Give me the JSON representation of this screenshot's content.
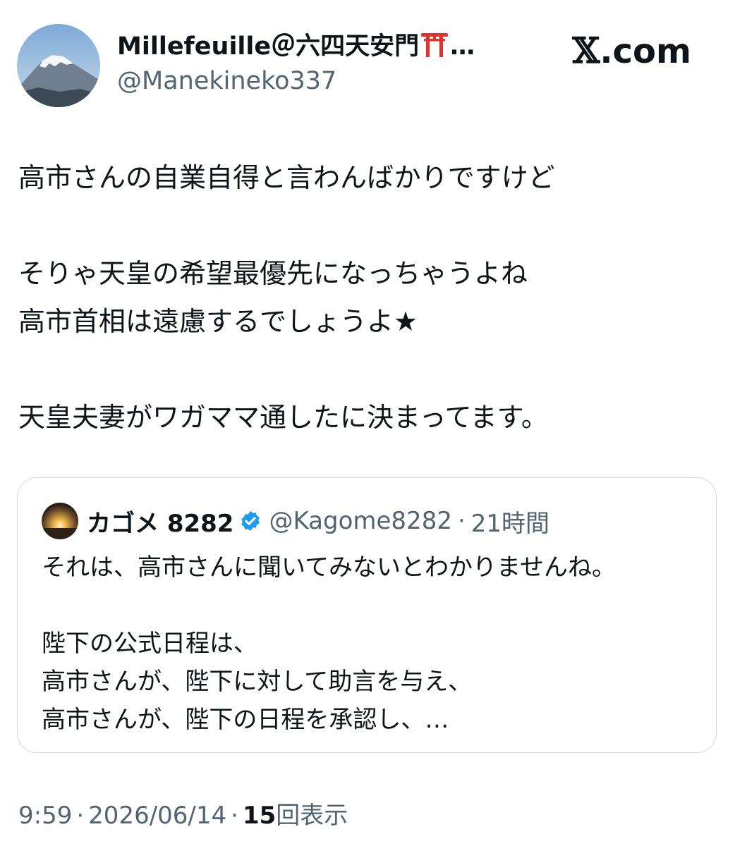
{
  "author": {
    "display_name": "Millefeuille＠六四天安門",
    "display_name_suffix": "…",
    "handle": "@Manekineko337",
    "avatar_icon": "mount-fuji-avatar-icon",
    "emoji_icon": "torii-gate-icon"
  },
  "brand": {
    "text": "X.com",
    "x_mark": "𝕏",
    "suffix": ".com"
  },
  "tweet": {
    "paragraphs": [
      "高市さんの自業自得と言わんばかりですけど",
      "そりゃ天皇の希望最優先になっちゃうよね\n高市首相は遠慮するでしょうよ★",
      "天皇夫妻がワガママ通したに決まってます。"
    ]
  },
  "quote": {
    "author_name": "カゴメ 8282",
    "verified_icon": "verified-badge-icon",
    "avatar_icon": "sunrise-avatar-icon",
    "handle": "@Kagome8282",
    "separator": "·",
    "time": "21時間",
    "paragraphs": [
      "それは、高市さんに聞いてみないとわかりませんね。",
      "陛下の公式日程は、\n高市さんが、陛下に対して助言を与え、\n高市さんが、陛下の日程を承認し、…"
    ]
  },
  "meta": {
    "time": "9:59",
    "separator": "·",
    "date": "2026/06/14",
    "views_count": "15",
    "views_label": "回表示"
  },
  "colors": {
    "text_primary": "#0f1419",
    "text_secondary": "#536471",
    "border": "#cfd9de",
    "verified": "#1d9bf0",
    "torii": "#e0322f"
  }
}
